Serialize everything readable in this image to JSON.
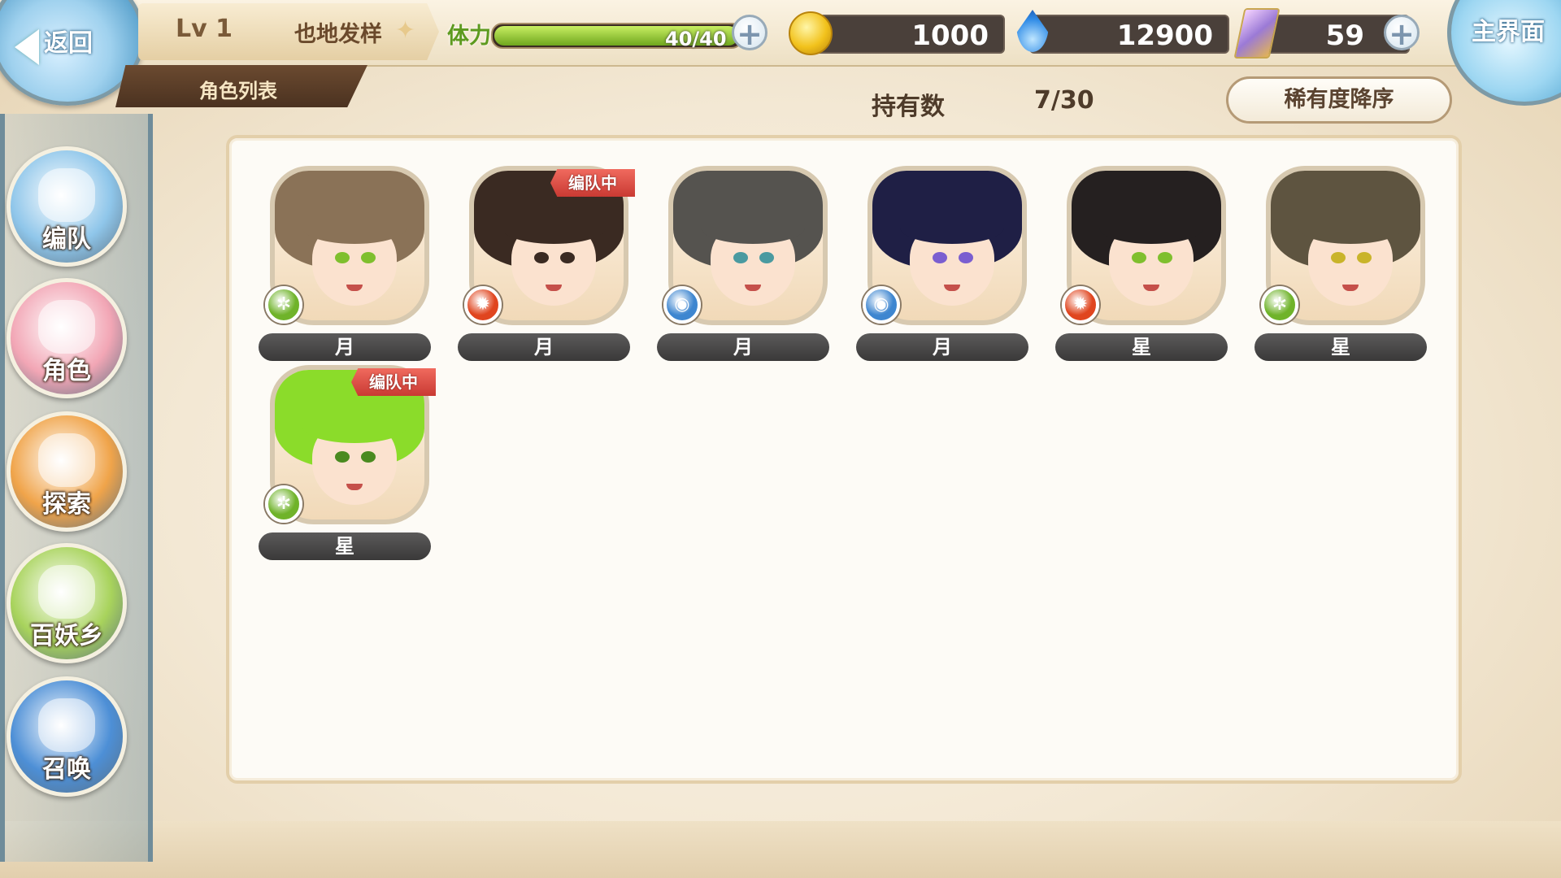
{
  "topbar": {
    "back_label": "返回",
    "level": "Lv 1",
    "player_name": "也地发样",
    "section_tab": "角色列表",
    "stamina_label": "体力",
    "stamina_text": "40/40",
    "stamina_fraction": 1.0,
    "gold": "1000",
    "spirit": "12900",
    "gems": "59",
    "plus_symbol": "+",
    "home_label": "主界面"
  },
  "header": {
    "owned_label": "持有数",
    "owned_value": "7/30",
    "sort_label": "稀有度降序"
  },
  "sidebar": {
    "items": [
      {
        "label": "编队",
        "icon": "team-icon",
        "color": "#8fc6ea"
      },
      {
        "label": "角色",
        "icon": "character-icon",
        "color": "#f2a6b5"
      },
      {
        "label": "探索",
        "icon": "explore-icon",
        "color": "#f0a44a"
      },
      {
        "label": "百妖乡",
        "icon": "village-icon",
        "color": "#a8d35c"
      },
      {
        "label": "召唤",
        "icon": "summon-icon",
        "color": "#4d8fd6"
      }
    ]
  },
  "characters": [
    {
      "rank": "月",
      "element": "wind",
      "element_color": "#6fb32a",
      "hair": "#8a7257",
      "eyes": "#7fbf2e",
      "in_team": false
    },
    {
      "rank": "月",
      "element": "fire",
      "element_color": "#e0451f",
      "hair": "#3a2a22",
      "eyes": "#3a2a22",
      "in_team": true
    },
    {
      "rank": "月",
      "element": "water",
      "element_color": "#3e86d0",
      "hair": "#55534f",
      "eyes": "#4a9aa0",
      "in_team": false
    },
    {
      "rank": "月",
      "element": "water",
      "element_color": "#3e86d0",
      "hair": "#1f1f45",
      "eyes": "#7a5ed0",
      "in_team": false
    },
    {
      "rank": "星",
      "element": "fire",
      "element_color": "#e0451f",
      "hair": "#252020",
      "eyes": "#7fbf2e",
      "in_team": false
    },
    {
      "rank": "星",
      "element": "wind",
      "element_color": "#6fb32a",
      "hair": "#5e5440",
      "eyes": "#c9b42a",
      "in_team": false
    },
    {
      "rank": "星",
      "element": "wind",
      "element_color": "#6fb32a",
      "hair": "#8bdc2a",
      "eyes": "#4a8a20",
      "in_team": true
    }
  ],
  "team_badge": "编队中"
}
